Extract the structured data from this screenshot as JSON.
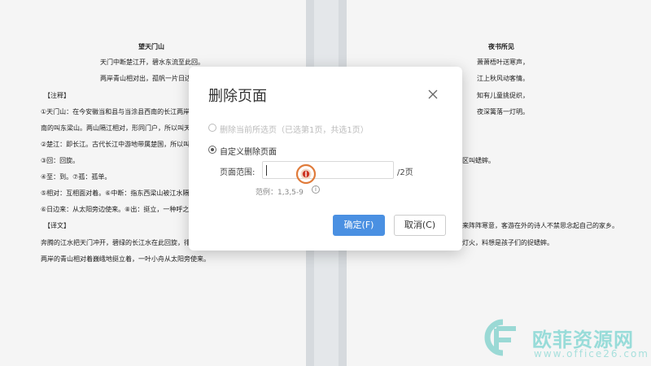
{
  "document": {
    "left_page": {
      "title": "望天门山",
      "lines": [
        "天门中断楚江开，碧水东流至此回。",
        "两岸青山相对出，孤帆一片日边",
        "【注释】",
        "①天门山：在今安徽当和县与当涂县西南的长江两岸，",
        "南的叫东梁山。两山隔江相对，形同门户，所以叫天",
        "②楚江：即长江。古代长江中游地带属楚国，所以叫",
        "③回：回旋。",
        "④至：到。⑦孤：孤单。",
        "⑤相对：互相面对着。⑥中断：指东西梁山被江水隔",
        "⑥日边来：从太阳旁边使来。⑧出：挺立，一种呼之",
        "【译文】",
        "奔腾的江水把天门冲开，碧绿的长江水在此回旋，徘",
        "两岸的青山相对着巍峨地挺立着，一叶小舟从太阳旁使来。"
      ]
    },
    "right_page": {
      "title": "夜书所见",
      "lines": [
        "萧萧梧叶送寒声，",
        "江上秋风动客情。",
        "知有儿童挑促织，",
        "夜深篱落一灯明。",
        "区叫蟋蟀。",
        "来阵阵寒意，客游在外的诗人不禁思念起自己的家乡。",
        "灯火，料想是孩子们的捉蟋蟀。"
      ]
    }
  },
  "dialog": {
    "title": "删除页面",
    "option_current": "删除当前所选页（已选第1页，共选1页）",
    "option_custom": "自定义删除页面",
    "range_label": "页面范围:",
    "range_value": "",
    "range_suffix": "/2页",
    "example": "范例：1,3,5-9",
    "confirm_label": "确定(F)",
    "cancel_label": "取消(C)",
    "accent_color": "#4a90e2"
  },
  "watermark": {
    "brand": "欧菲资源网",
    "url": "www.office26.com"
  }
}
